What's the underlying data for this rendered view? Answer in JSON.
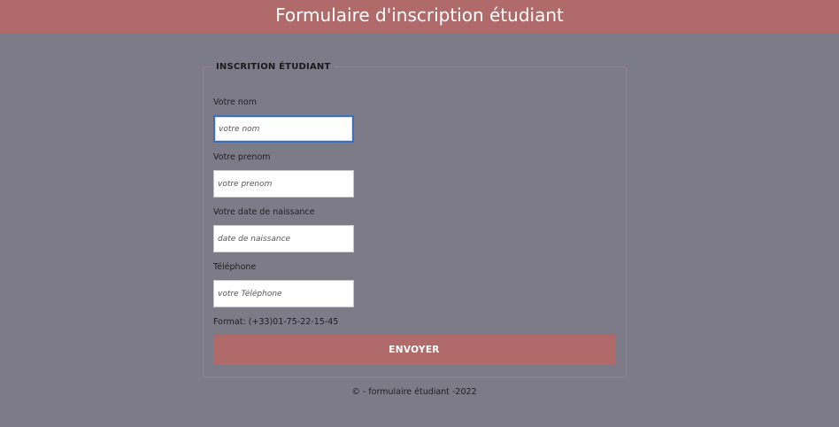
{
  "header": {
    "title": "Formulaire d'inscription étudiant"
  },
  "form": {
    "legend": "INSCRITION ÉTUDIANT",
    "fields": [
      {
        "label": "Votre nom",
        "placeholder": "votre nom",
        "value": "",
        "focused": true
      },
      {
        "label": "Votre prenom",
        "placeholder": "votre prenom",
        "value": ""
      },
      {
        "label": "Votre date de naissance",
        "placeholder": "date de naissance",
        "value": ""
      },
      {
        "label": "Téléphone",
        "placeholder": "votre Téléphone",
        "value": ""
      }
    ],
    "phone_format_hint": "Format: (+33)01-75-22-15-45",
    "submit_label": "ENVOYER"
  },
  "footer": {
    "text": "© - formulaire étudiant -2022"
  },
  "colors": {
    "background": "#7e7b89",
    "accent": "#b06a69",
    "focus_border": "#3f6fb5"
  }
}
